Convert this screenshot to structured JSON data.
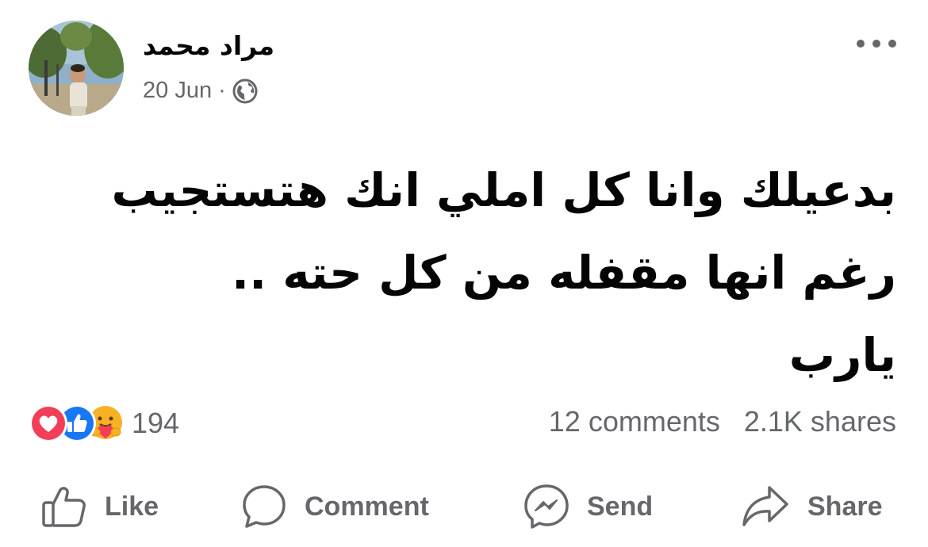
{
  "post": {
    "author": "مراد محمد",
    "date": "20 Jun",
    "date_separator": "·",
    "privacy_icon": "globe-icon",
    "text_lines": [
      "بدعيلك وانا كل املي انك هتستجيب",
      "رغم انها مقفله من كل حته ..",
      "يارب"
    ]
  },
  "reactions": {
    "icons": [
      "love-icon",
      "like-icon",
      "care-icon"
    ],
    "count": "194",
    "comments": "12 comments",
    "shares": "2.1K shares"
  },
  "actions": {
    "like": "Like",
    "comment": "Comment",
    "send": "Send",
    "share": "Share"
  },
  "colors": {
    "love": "#f33e58",
    "like": "#1877f2",
    "care": "#f7b125",
    "secondary_text": "#65676b"
  }
}
